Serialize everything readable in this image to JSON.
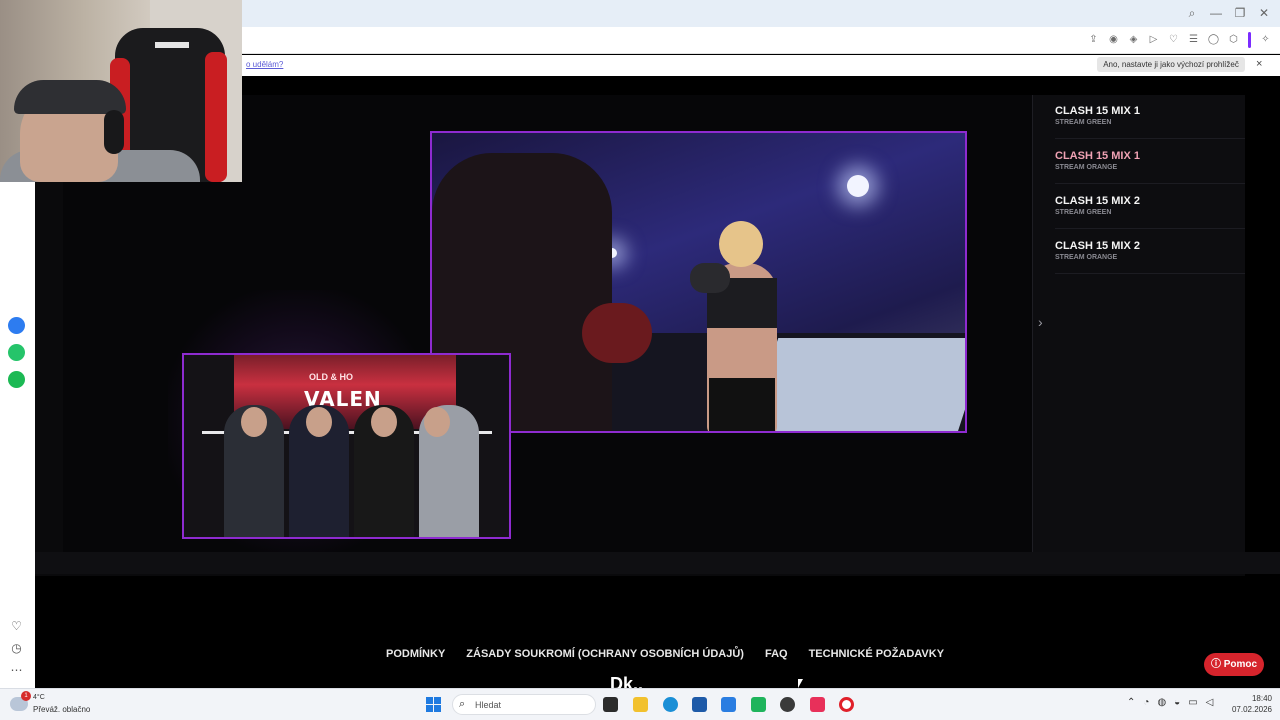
{
  "browser": {
    "notification_link": "o udělám?",
    "notification_button": "Ano, nastavte ji jako výchozí prohlížeč",
    "notification_close": "×"
  },
  "streams": [
    {
      "title": "CLASH 15 MIX 1",
      "subtitle": "STREAM GREEN",
      "active": false
    },
    {
      "title": "CLASH 15 MIX 1",
      "subtitle": "STREAM ORANGE",
      "active": true
    },
    {
      "title": "CLASH 15 MIX 2",
      "subtitle": "STREAM GREEN",
      "active": false
    },
    {
      "title": "CLASH 15 MIX 2",
      "subtitle": "STREAM ORANGE",
      "active": false
    }
  ],
  "pip": {
    "banner_title": "VALEN",
    "banner_sub": "OLD & HO"
  },
  "footer": {
    "links": [
      "PODMÍNKY",
      "ZÁSADY SOUKROMÍ (OCHRANY OSOBNÍCH ÚDAJŮ)",
      "FAQ",
      "TECHNICKÉ POŽADAVKY"
    ],
    "help_label": "Pomoc",
    "partial_heading": "Dk.."
  },
  "taskbar": {
    "weather_badge": "1",
    "weather_temp": "4°C",
    "weather_desc": "Převáž. oblačno",
    "search_placeholder": "Hledat",
    "time": "18:40",
    "date": "07.02.2026"
  },
  "colors": {
    "accent_purple": "#8e2bd0",
    "active_stream": "#f0a2b4",
    "help_red": "#d6242c"
  }
}
